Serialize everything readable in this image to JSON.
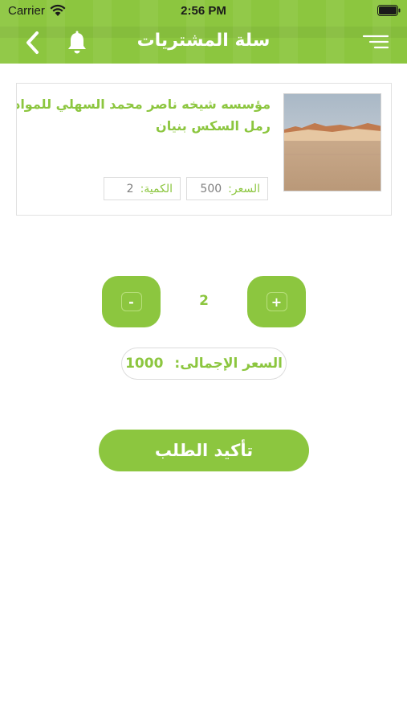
{
  "status_bar": {
    "carrier": "Carrier",
    "time": "2:56 PM",
    "wifi_icon": "wifi-icon",
    "battery_icon": "battery-full-icon"
  },
  "nav": {
    "title": "سلة المشتريات",
    "back_icon": "chevron-left-icon",
    "notification_icon": "bell-icon",
    "menu_icon": "menu-icon"
  },
  "cart_item": {
    "name": "مؤسسه شيخه ناصر محمد السهلي للمواد ا",
    "subtitle": "رمل السكس بنيان",
    "price_label": "السعر:",
    "price_value": "500",
    "quantity_label": "الكمية:",
    "quantity_value": "2",
    "image_icon": "product-photo-sand"
  },
  "stepper": {
    "minus_label": "-",
    "plus_label": "+",
    "quantity": "2"
  },
  "total": {
    "label": "السعر الإجمالى:",
    "value": "1000"
  },
  "confirm_button": {
    "label": "تأكيد الطلب"
  },
  "colors": {
    "accent": "#8cc63f",
    "border": "#dcdcdc",
    "text_muted": "#7f7f7f"
  }
}
